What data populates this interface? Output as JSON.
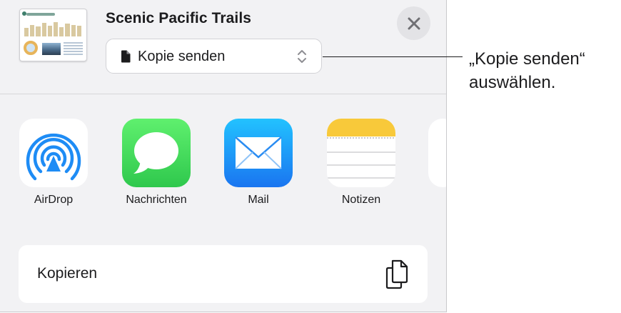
{
  "document": {
    "title": "Scenic Pacific Trails",
    "thumbnail_icon": "presentation-thumbnail"
  },
  "header": {
    "send_option": "Kopie senden",
    "close_icon": "close-icon"
  },
  "apps": [
    {
      "label": "AirDrop",
      "icon": "airdrop-icon"
    },
    {
      "label": "Nachrichten",
      "icon": "messages-icon"
    },
    {
      "label": "Mail",
      "icon": "mail-icon"
    },
    {
      "label": "Notizen",
      "icon": "notes-icon"
    }
  ],
  "actions": [
    {
      "label": "Kopieren",
      "icon": "copy-icon"
    }
  ],
  "callout": {
    "line1": "„Kopie senden“",
    "line2": "auswählen."
  },
  "colors": {
    "sheet_background": "#f2f2f4",
    "airdrop_blue": "#1e8cf5",
    "messages_green": "#2fc84d",
    "mail_blue": "#1a8cf5",
    "notes_yellow": "#f8c93a"
  }
}
